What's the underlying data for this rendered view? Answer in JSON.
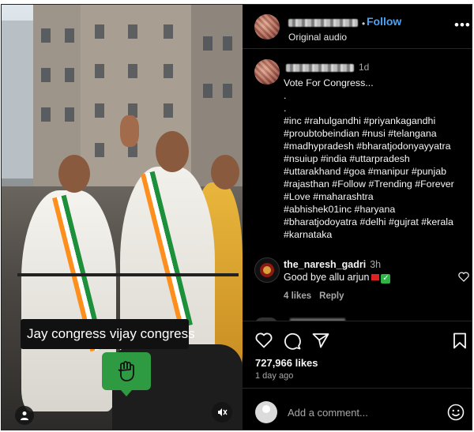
{
  "video": {
    "caption_text": "Jay congress vijay congress",
    "user_icon": "user-icon",
    "mute_icon": "muted-speaker-icon",
    "sticker_icon": "raised-fist-icon",
    "sticker_color": "#2e9a42"
  },
  "header": {
    "username": "",
    "follow_label": "Follow",
    "audio_label": "Original audio",
    "more_icon": "more-options-icon",
    "follow_color": "#4aa3f6"
  },
  "caption": {
    "username": "",
    "time": "1d",
    "lines": [
      "Vote For Congress...",
      ".",
      ".",
      "#inc #rahulgandhi #priyankagandhi",
      "#proubtobeindian  #nusi #telangana",
      "#madhypradesh  #bharatjodonyayyatra",
      "#nsuiup  #india #uttarpradesh",
      "#uttarakhand #goa #manipur #punjab",
      "#rajasthan  #Follow #Trending #Forever",
      "#Love #maharashtra",
      "#abhishek01inc #haryana",
      "#bharatjodoyatra #delhi #gujrat #kerala",
      "#karnataka"
    ]
  },
  "comment": {
    "username": "the_naresh_gadri",
    "time": "3h",
    "text": "Good bye allu arjun",
    "likes": "4 likes",
    "reply_label": "Reply",
    "heart_icon": "heart-outline-icon"
  },
  "actions": {
    "like_icon": "heart-icon",
    "comment_icon": "comment-icon",
    "share_icon": "share-icon",
    "save_icon": "bookmark-icon",
    "likes_count": "727,966 likes",
    "posted_ago": "1 day ago"
  },
  "add_comment": {
    "placeholder": "Add a comment...",
    "emoji_icon": "emoji-icon"
  }
}
